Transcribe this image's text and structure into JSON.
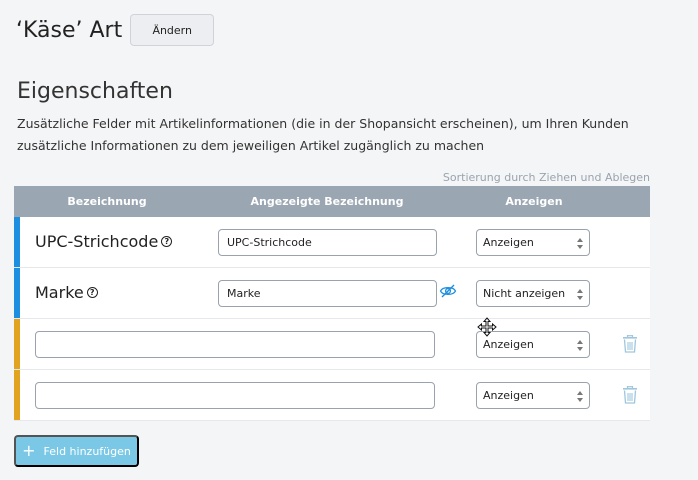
{
  "header": {
    "title": "‘Käse’ Art",
    "change_label": "Ändern"
  },
  "section": {
    "title": "Eigenschaften",
    "description": "Zusätzliche Felder mit Artikelinformationen (die in der Shopansicht erscheinen), um Ihren Kunden zusätzliche Informationen zu dem jeweiligen Artikel zugänglich zu machen",
    "sort_hint": "Sortierung durch Ziehen und Ablegen"
  },
  "table": {
    "columns": [
      "Bezeichnung",
      "Angezeigte Bezeichnung",
      "Anzeigen"
    ],
    "rows": [
      {
        "label": "UPC-Strichcode",
        "display": "UPC-Strichcode",
        "visibility": "Anzeigen",
        "bar_color": "#1c8fe0",
        "help_icon": "question-circle-icon"
      },
      {
        "label": "Marke",
        "display": "Marke",
        "visibility": "Nicht anzeigen",
        "bar_color": "#1c8fe0",
        "help_icon": "question-circle-icon",
        "status_icon": "eye-slash-icon"
      },
      {
        "label": "",
        "display": "",
        "visibility": "Anzeigen",
        "bar_color": "#e2a321",
        "action_icon": "trash-icon"
      },
      {
        "label": "",
        "display": "",
        "visibility": "Anzeigen",
        "bar_color": "#e2a321",
        "action_icon": "trash-icon"
      }
    ]
  },
  "footer": {
    "add_label": "Feld hinzufügen"
  },
  "colors": {
    "header_bg": "#9aa6b2",
    "accent_blue": "#1c8fe0",
    "accent_orange": "#e2a321",
    "add_button": "#7bc8e6"
  }
}
